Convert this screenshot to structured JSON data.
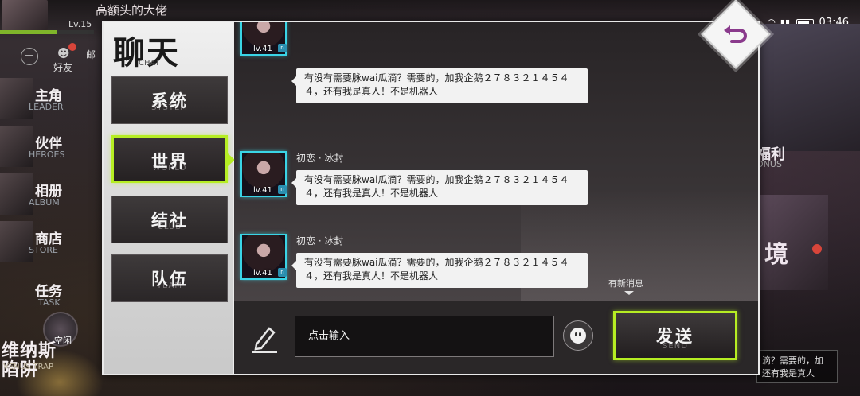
{
  "background": {
    "username": "高额头的大佬",
    "level": "Lv.15",
    "time": "03:46",
    "friends_label": "好友",
    "mail_label": "邮",
    "side_menu": [
      {
        "cn": "主角",
        "en": "LEADER"
      },
      {
        "cn": "伙伴",
        "en": "HEROES"
      },
      {
        "cn": "相册",
        "en": "ALBUM"
      },
      {
        "cn": "商店",
        "en": "STORE"
      }
    ],
    "task": {
      "cn": "任务",
      "en": "TASK"
    },
    "idle_label": "空闲",
    "venus": {
      "cn": "维纳斯\n陷阱",
      "en": "VENUS TRAP"
    },
    "welfare": {
      "cn": "福利",
      "en": "ONUS"
    },
    "realm_char": "境",
    "ticker": "滴？需要的，加\n还有我是真人"
  },
  "dialog": {
    "title_cn": "聊天",
    "title_en": "CHAT",
    "tabs": [
      {
        "cn": "系统",
        "en": "SYSTEM",
        "active": false
      },
      {
        "cn": "世界",
        "en": "WORLD",
        "active": true
      },
      {
        "cn": "结社",
        "en": "CLUB",
        "active": false
      },
      {
        "cn": "队伍",
        "en": "TEAM",
        "active": false
      }
    ],
    "messages": [
      {
        "nickname": "",
        "level": "lv.41",
        "text": "有没有需要脉wai瓜滴？需要的，加我企鹅２７８３２１４５４４，还有我是真人！不是机器人"
      },
      {
        "nickname": "初恋 · 冰封",
        "level": "lv.41",
        "text": "有没有需要脉wai瓜滴？需要的，加我企鹅２７８３２１４５４４，还有我是真人！不是机器人"
      },
      {
        "nickname": "初恋 · 冰封",
        "level": "lv.41",
        "text": "有没有需要脉wai瓜滴？需要的，加我企鹅２７８３２１４５４４，还有我是真人！不是机器人"
      }
    ],
    "new_message_hint": "有新消息",
    "input": {
      "placeholder": "点击输入"
    },
    "send": {
      "cn": "发送",
      "en": "SEND"
    }
  },
  "colors": {
    "accent_green": "#b6ee23",
    "avatar_border": "#3ad4e6",
    "back_icon": "#8a3a8c"
  }
}
